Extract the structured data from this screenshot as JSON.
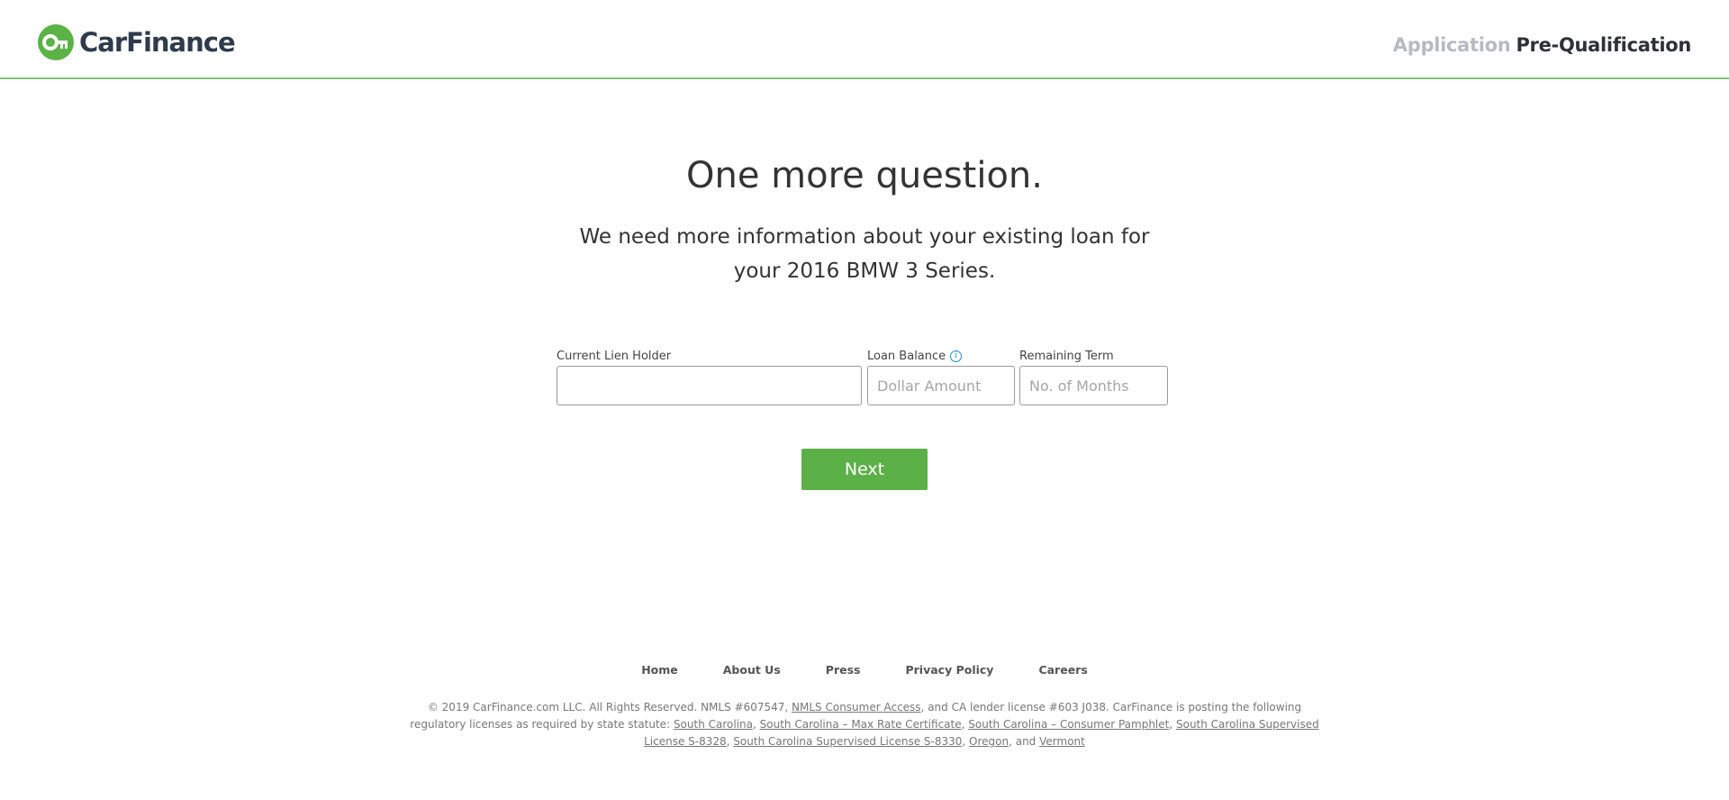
{
  "header": {
    "logo_text": "CarFinance",
    "steps": [
      {
        "label": "Application",
        "state": "inactive"
      },
      {
        "label": "Pre-Qualification",
        "state": "active"
      }
    ]
  },
  "main": {
    "headline": "One more question.",
    "subhead": "We need more information about your existing loan for your 2016 BMW 3 Series.",
    "fields": {
      "lien_holder": {
        "label": "Current Lien Holder",
        "value": "",
        "placeholder": ""
      },
      "loan_balance": {
        "label": "Loan Balance",
        "value": "",
        "placeholder": "Dollar Amount",
        "info_icon": "info-icon"
      },
      "remaining_term": {
        "label": "Remaining Term",
        "value": "",
        "placeholder": "No. of Months"
      }
    },
    "next_label": "Next"
  },
  "footer": {
    "nav": [
      "Home",
      "About Us",
      "Press",
      "Privacy Policy",
      "Careers"
    ],
    "legal_1": "© 2019 CarFinance.com LLC. All Rights Reserved. NMLS #607547,",
    "legal_link_nmls": "NMLS Consumer Access",
    "legal_2": ", and CA lender license #603 J038. CarFinance is posting the following regulatory licenses as required by state statute:",
    "legal_links": [
      "South Carolina",
      "South Carolina – Max Rate Certificate",
      "South Carolina – Consumer Pamphlet",
      "South Carolina Supervised License S-8328",
      "South Carolina Supervised License S-8330",
      "Oregon",
      "Vermont"
    ],
    "legal_and": ", and"
  },
  "colors": {
    "brand_green": "#5cb048",
    "header_border": "#7dc07a",
    "logo_text": "#2f3b4b",
    "step_inactive": "#b7babf",
    "info_blue": "#1b8fd0"
  }
}
